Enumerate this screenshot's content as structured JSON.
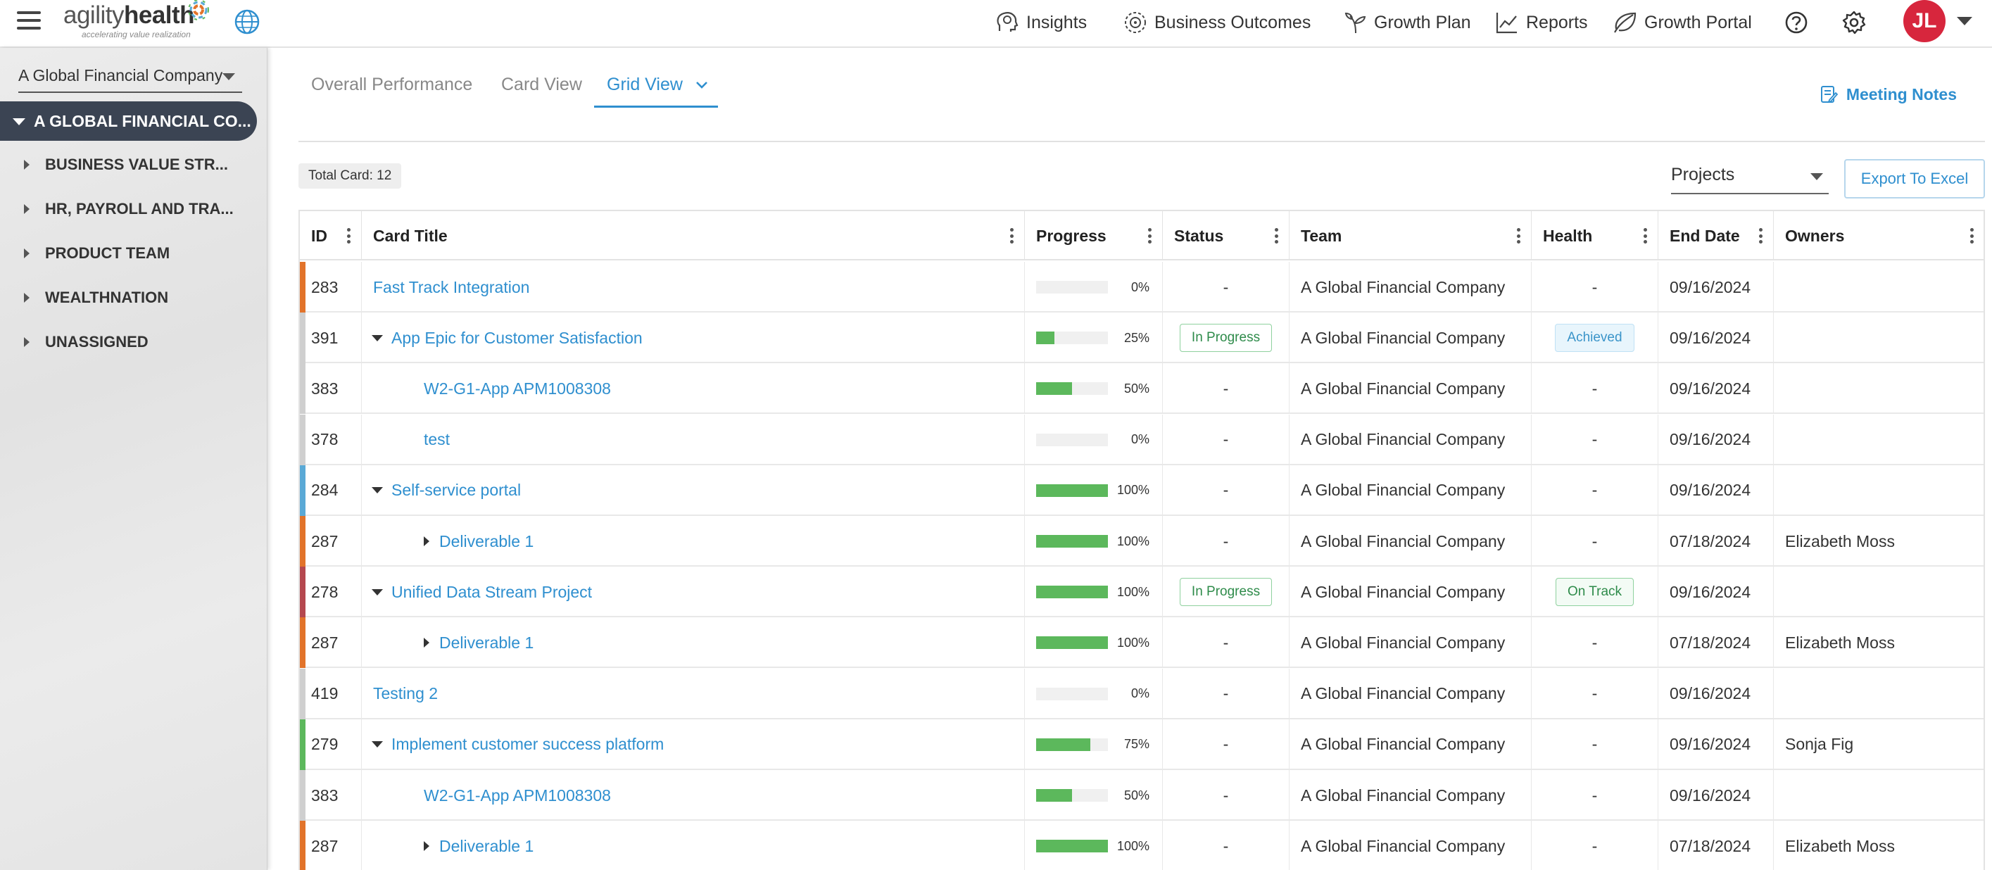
{
  "header": {
    "logo_word_a": "agility",
    "logo_word_b": "health",
    "logo_tagline": "accelerating value realization",
    "nav": [
      "Insights",
      "Business Outcomes",
      "Growth Plan",
      "Reports",
      "Growth Portal"
    ],
    "user_initials": "JL",
    "avatar_color": "#d7263d"
  },
  "sidebar": {
    "company_select": "A Global Financial Company",
    "root": "A GLOBAL FINANCIAL CO...",
    "items": [
      "BUSINESS VALUE STR...",
      "HR, PAYROLL AND TRA...",
      "PRODUCT TEAM",
      "WEALTHNATION",
      "UNASSIGNED"
    ]
  },
  "tabs": {
    "items": [
      "Overall Performance",
      "Card View",
      "Grid View"
    ],
    "active": "Grid View",
    "meeting_notes": "Meeting Notes"
  },
  "toolbar": {
    "total_label": "Total Card: 12",
    "projects_select": "Projects",
    "export_label": "Export To Excel"
  },
  "grid": {
    "columns": [
      "ID",
      "Card Title",
      "Progress",
      "Status",
      "Team",
      "Health",
      "End Date",
      "Owners"
    ],
    "rows": [
      {
        "id": "283",
        "title": "Fast Track Integration",
        "level": 0,
        "expander": "none",
        "progress": 0,
        "progress_label": "0%",
        "status": "-",
        "team": "A Global Financial Company",
        "health": "-",
        "end_date": "09/16/2024",
        "owners": "",
        "bar_color": "#e2732a"
      },
      {
        "id": "391",
        "title": "App Epic for Customer Satisfaction",
        "level": 0,
        "expander": "down",
        "progress": 25,
        "progress_label": "25%",
        "status": "In Progress",
        "team": "A Global Financial Company",
        "health": "Achieved",
        "end_date": "09/16/2024",
        "owners": "",
        "bar_color": "#cfcfcf"
      },
      {
        "id": "383",
        "title": "W2-G1-App APM1008308",
        "level": 2,
        "expander": "none",
        "progress": 50,
        "progress_label": "50%",
        "status": "-",
        "team": "A Global Financial Company",
        "health": "-",
        "end_date": "09/16/2024",
        "owners": "",
        "bar_color": "#cfcfcf"
      },
      {
        "id": "378",
        "title": "test",
        "level": 2,
        "expander": "none",
        "progress": 0,
        "progress_label": "0%",
        "status": "-",
        "team": "A Global Financial Company",
        "health": "-",
        "end_date": "09/16/2024",
        "owners": "",
        "bar_color": "#cfcfcf"
      },
      {
        "id": "284",
        "title": "Self-service portal",
        "level": 0,
        "expander": "down",
        "progress": 100,
        "progress_label": "100%",
        "status": "-",
        "team": "A Global Financial Company",
        "health": "-",
        "end_date": "09/16/2024",
        "owners": "",
        "bar_color": "#5aa9d6"
      },
      {
        "id": "287",
        "title": "Deliverable 1",
        "level": 1,
        "expander": "right",
        "progress": 100,
        "progress_label": "100%",
        "status": "-",
        "team": "A Global Financial Company",
        "health": "-",
        "end_date": "07/18/2024",
        "owners": "Elizabeth Moss",
        "bar_color": "#e2732a"
      },
      {
        "id": "278",
        "title": "Unified Data Stream Project",
        "level": 0,
        "expander": "down",
        "progress": 100,
        "progress_label": "100%",
        "status": "In Progress",
        "team": "A Global Financial Company",
        "health": "On Track",
        "end_date": "09/16/2024",
        "owners": "",
        "bar_color": "#b5484f"
      },
      {
        "id": "287",
        "title": "Deliverable 1",
        "level": 1,
        "expander": "right",
        "progress": 100,
        "progress_label": "100%",
        "status": "-",
        "team": "A Global Financial Company",
        "health": "-",
        "end_date": "07/18/2024",
        "owners": "Elizabeth Moss",
        "bar_color": "#e2732a"
      },
      {
        "id": "419",
        "title": "Testing 2",
        "level": 0,
        "expander": "none",
        "progress": 0,
        "progress_label": "0%",
        "status": "-",
        "team": "A Global Financial Company",
        "health": "-",
        "end_date": "09/16/2024",
        "owners": "",
        "bar_color": "#cfcfcf"
      },
      {
        "id": "279",
        "title": "Implement customer success platform",
        "level": 0,
        "expander": "down",
        "progress": 75,
        "progress_label": "75%",
        "status": "-",
        "team": "A Global Financial Company",
        "health": "-",
        "end_date": "09/16/2024",
        "owners": "Sonja Fig",
        "bar_color": "#5cb85c"
      },
      {
        "id": "383",
        "title": "W2-G1-App APM1008308",
        "level": 2,
        "expander": "none",
        "progress": 50,
        "progress_label": "50%",
        "status": "-",
        "team": "A Global Financial Company",
        "health": "-",
        "end_date": "09/16/2024",
        "owners": "",
        "bar_color": "#cfcfcf"
      },
      {
        "id": "287",
        "title": "Deliverable 1",
        "level": 1,
        "expander": "right",
        "progress": 100,
        "progress_label": "100%",
        "status": "-",
        "team": "A Global Financial Company",
        "health": "-",
        "end_date": "07/18/2024",
        "owners": "Elizabeth Moss",
        "bar_color": "#e2732a"
      }
    ]
  },
  "colors": {
    "accent": "#2f8fcf",
    "progress_green": "#5cb85c",
    "sidebar_root_bg": "#3b4453"
  }
}
